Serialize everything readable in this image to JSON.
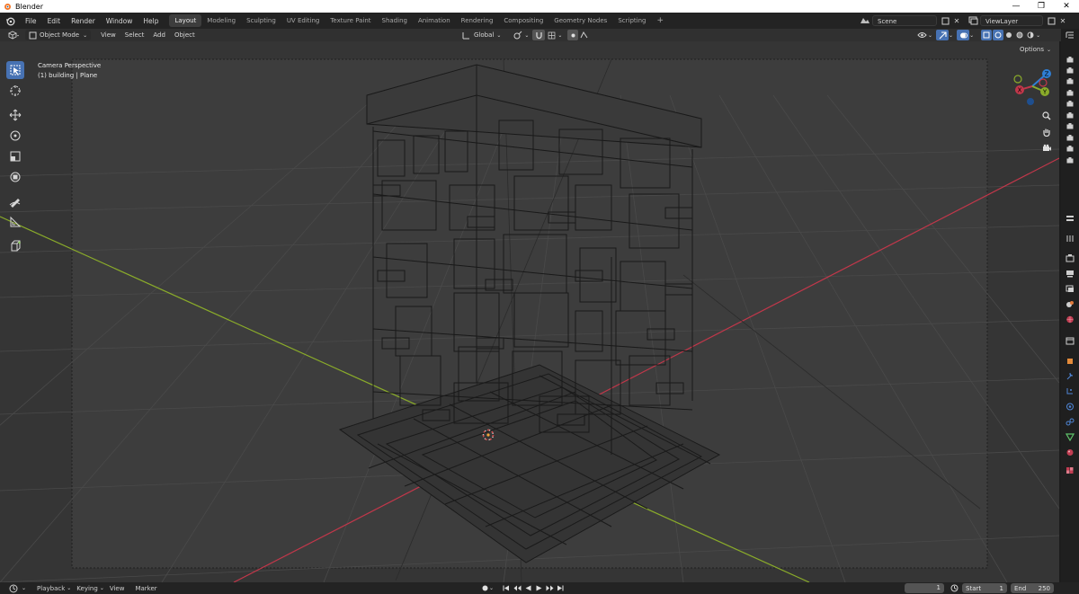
{
  "window": {
    "title": "Blender",
    "logo_icon": "blender-logo-icon",
    "controls": [
      "minimize",
      "restore",
      "close"
    ]
  },
  "menu": [
    "File",
    "Edit",
    "Render",
    "Window",
    "Help"
  ],
  "workspaces": [
    {
      "label": "Layout",
      "active": true
    },
    {
      "label": "Modeling",
      "active": false
    },
    {
      "label": "Sculpting",
      "active": false
    },
    {
      "label": "UV Editing",
      "active": false
    },
    {
      "label": "Texture Paint",
      "active": false
    },
    {
      "label": "Shading",
      "active": false
    },
    {
      "label": "Animation",
      "active": false
    },
    {
      "label": "Rendering",
      "active": false
    },
    {
      "label": "Compositing",
      "active": false
    },
    {
      "label": "Geometry Nodes",
      "active": false
    },
    {
      "label": "Scripting",
      "active": false
    }
  ],
  "add_workspace": "+",
  "scene": {
    "name": "Scene"
  },
  "view_layer": {
    "name": "ViewLayer"
  },
  "header": {
    "mode": "Object Mode",
    "menus": [
      "View",
      "Select",
      "Add",
      "Object"
    ],
    "orientation": "Global",
    "options": "Options"
  },
  "viewport": {
    "perspective": "Camera Perspective",
    "object_info": "(1) building | Plane",
    "gizmo_axes": [
      "X",
      "Y",
      "Z"
    ],
    "colors": {
      "x_axis": "#c1374a",
      "y_axis": "#8aab2a",
      "z_axis": "#2f7fd6",
      "select": "#4772b3",
      "background": "#3d3d3d"
    }
  },
  "tools": [
    "select-box-icon",
    "cursor-icon",
    "move-icon",
    "rotate-icon",
    "scale-icon",
    "transform-icon",
    "annotate-icon",
    "measure-icon",
    "add-cube-icon"
  ],
  "timeline": {
    "menus": [
      "Playback",
      "Keying",
      "View",
      "Marker"
    ],
    "current_frame": "1",
    "start_label": "Start",
    "start": "1",
    "end_label": "End",
    "end": "250"
  }
}
